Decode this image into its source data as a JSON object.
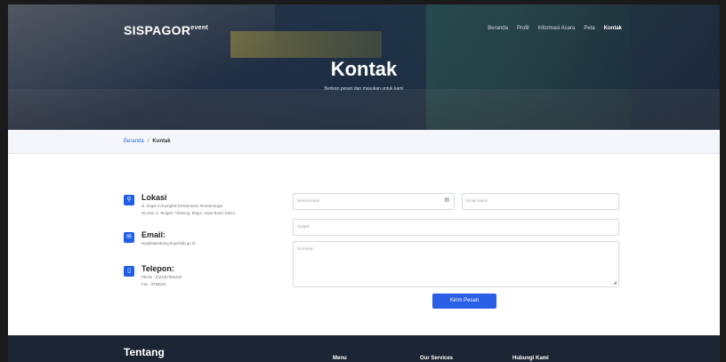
{
  "header": {
    "brand": "SISPAGOR",
    "brand_sup": "event",
    "nav": [
      "Beranda",
      "Profil",
      "Informasi Acara",
      "Peta",
      "Kontak"
    ],
    "active_nav": "Kontak"
  },
  "hero": {
    "title": "Kontak",
    "subtitle": "Berikan pesan dan masukan untuk kami"
  },
  "breadcrumb": {
    "home": "Beranda",
    "separator": "/",
    "current": "Kontak"
  },
  "contact": {
    "location": {
      "icon": "map-pin-icon",
      "title": "Lokasi",
      "line1": "Jl. Segar III Komplek Perkantoran Pemda Bogor",
      "line2": "No.Kav. 2, Tengah, Cibinong, Bogor, Jawa Barat 16914"
    },
    "email": {
      "icon": "envelope-icon",
      "title": "Email:",
      "value": "kepjabatanbang.bogorkab.go.id"
    },
    "phone": {
      "icon": "phone-icon",
      "title": "Telepon:",
      "phone": "Phone : (021)87906240",
      "fax": "Fax : 8790624"
    }
  },
  "form": {
    "name_placeholder": "Nama Kamu",
    "email_placeholder": "Email Kamu",
    "subject_placeholder": "Subjek",
    "message_placeholder": "Isi Pesan",
    "submit_label": "Kirim Pesan"
  },
  "footer": {
    "about": "Tentang",
    "menu": "Menu",
    "services": "Our Services",
    "contact": "Hubungi Kami"
  },
  "colors": {
    "accent": "#2a60e6",
    "footer_bg": "#1c2533"
  }
}
